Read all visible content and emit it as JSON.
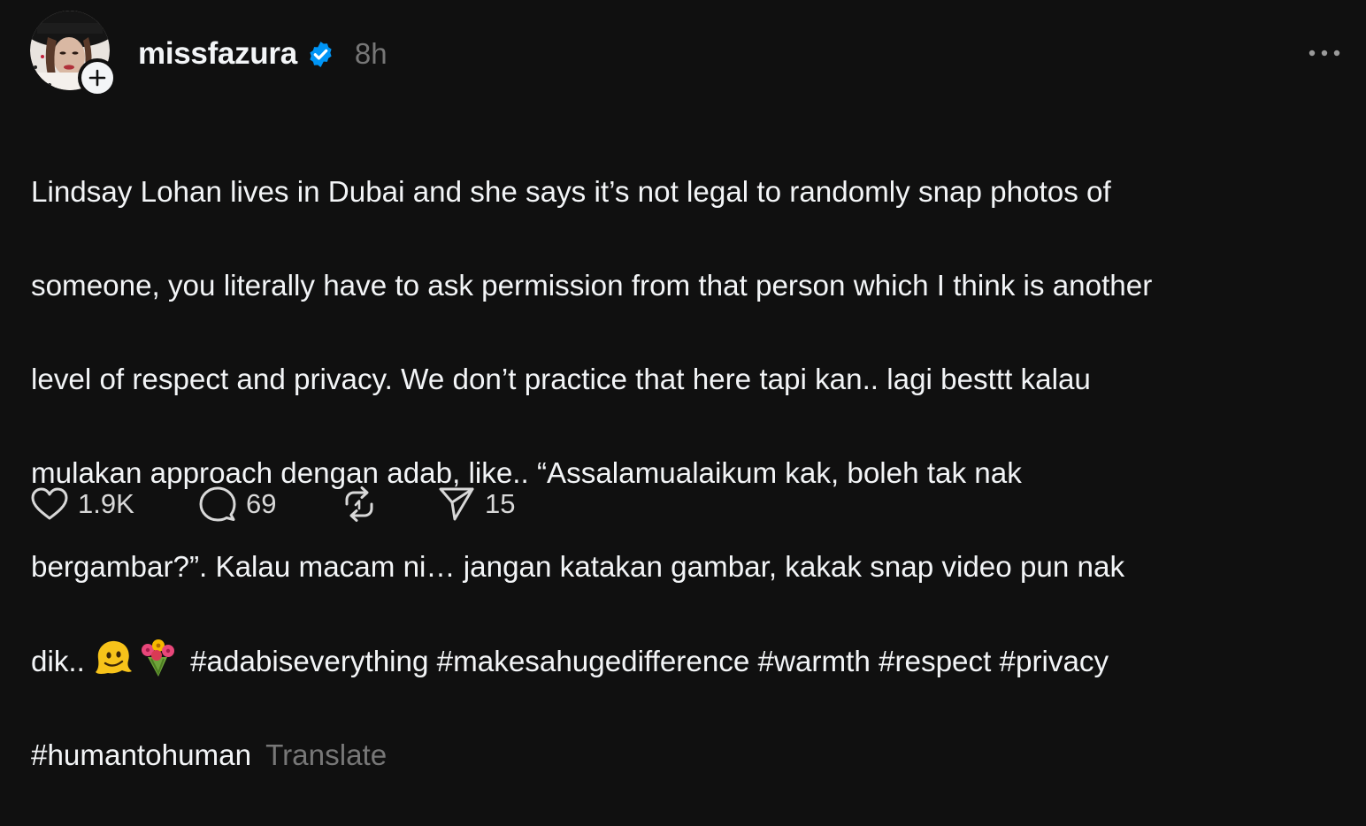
{
  "post": {
    "username": "missfazura",
    "time": "8h",
    "lines": [
      "Lindsay Lohan lives in Dubai and she says it’s not legal to randomly snap photos of",
      "someone, you literally have to ask permission from that person which I think is another",
      "level of respect and privacy. We don’t practice that here tapi kan.. lagi besttt kalau",
      "mulakan approach dengan adab, like.. “Assalamualaikum kak, boleh tak nak",
      "bergambar?”. Kalau macam ni… jangan katakan gambar, kakak snap video pun nak"
    ],
    "line6_prefix": "dik.. ",
    "line6_hashtags": "#adabiseverything #makesahugedifference #warmth #respect #privacy",
    "line7_hashtag": "#humantohuman",
    "translate": "Translate",
    "emojis": [
      "melting-face",
      "bouquet"
    ]
  },
  "actions": {
    "likes": "1.9K",
    "replies": "69",
    "shares": "15"
  },
  "colors": {
    "background": "#101010",
    "text": "#f3f5f7",
    "muted": "#777777",
    "verified": "#0095f6"
  }
}
